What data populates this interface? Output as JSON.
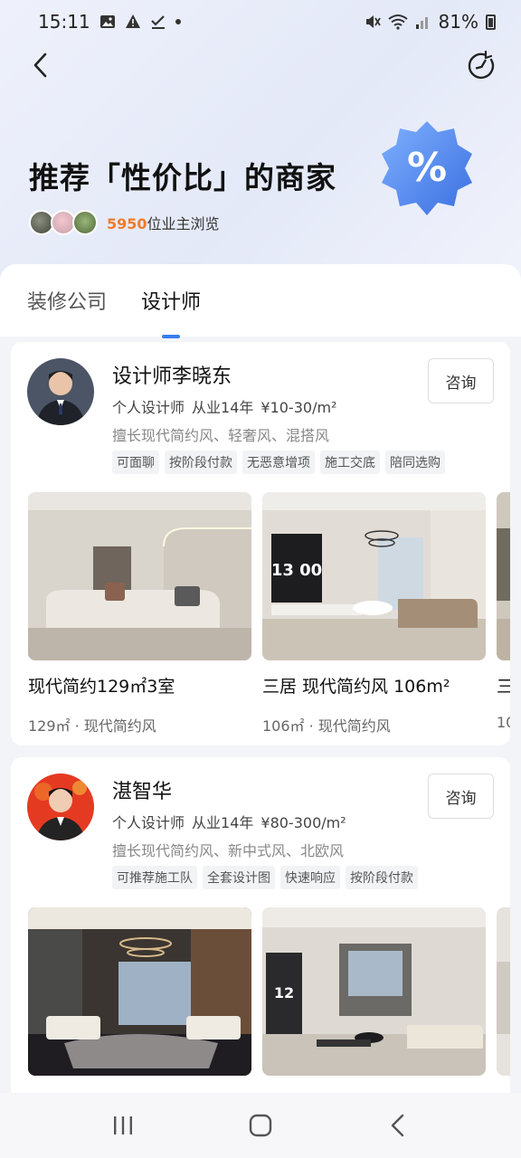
{
  "status": {
    "time": "15:11",
    "battery": "81%"
  },
  "hero": {
    "title": "推荐「性价比」的商家",
    "viewers_count": "5950",
    "viewers_suffix": "位业主浏览",
    "badge_symbol": "%",
    "badge_color": "#4a86f0"
  },
  "tabs": [
    "装修公司",
    "设计师"
  ],
  "active_tab": "设计师",
  "designers": [
    {
      "name": "设计师李晓东",
      "role": "个人设计师",
      "experience": "从业14年",
      "price": "¥10-30/m²",
      "skills": "擅长现代简约风、轻奢风、混搭风",
      "tags": [
        "可面聊",
        "按阶段付款",
        "无恶意增项",
        "施工交底",
        "陪同选购"
      ],
      "consult_label": "咨询",
      "cases": [
        {
          "title": "现代简约129㎡3室",
          "sub": "129㎡ · 现代简约风"
        },
        {
          "title": "三居 现代简约风 106m²",
          "sub": "106㎡ · 现代简约风",
          "tv_text": "13 00"
        },
        {
          "title": "三",
          "sub": "10"
        }
      ]
    },
    {
      "name": "湛智华",
      "role": "个人设计师",
      "experience": "从业14年",
      "price": "¥80-300/m²",
      "skills": "擅长现代简约风、新中式风、北欧风",
      "tags": [
        "可推荐施工队",
        "全套设计图",
        "快速响应",
        "按阶段付款"
      ],
      "consult_label": "咨询",
      "cases": [
        {
          "title": "",
          "sub": ""
        },
        {
          "title": "",
          "sub": "",
          "tv_text": "12"
        },
        {
          "title": "",
          "sub": ""
        }
      ]
    }
  ],
  "colors": {
    "accent": "#3a7cf0",
    "highlight": "#f07b2a"
  }
}
